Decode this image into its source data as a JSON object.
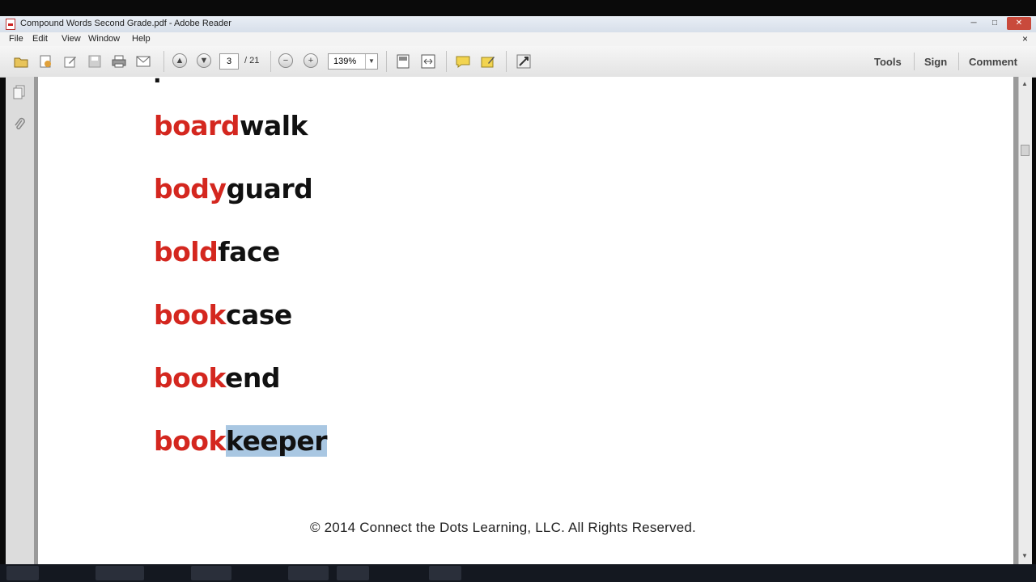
{
  "window": {
    "title": "Compound Words Second Grade.pdf - Adobe Reader",
    "controls": {
      "minimize": "─",
      "maximize": "□",
      "close": "✕"
    }
  },
  "menu": {
    "items": [
      "File",
      "Edit",
      "View",
      "Window",
      "Help"
    ],
    "doc_close": "×"
  },
  "toolbar": {
    "page_current": "3",
    "page_total": "/ 21",
    "zoom": "139%",
    "tools_label": "Tools",
    "sign_label": "Sign",
    "comment_label": "Comment"
  },
  "document": {
    "cutoff_text": "·",
    "words": [
      {
        "first": "board",
        "second": "walk",
        "selected": false
      },
      {
        "first": "body",
        "second": "guard",
        "selected": false
      },
      {
        "first": "bold",
        "second": "face",
        "selected": false
      },
      {
        "first": "book",
        "second": "case",
        "selected": false
      },
      {
        "first": "book",
        "second": "end",
        "selected": false
      },
      {
        "first": "book",
        "second": "keeper",
        "selected": true
      }
    ],
    "footer": "© 2014 Connect the Dots Learning, LLC. All Rights Reserved."
  },
  "colors": {
    "first_part": "#d4271f",
    "second_part": "#111111",
    "selection": "#a9c7e2"
  }
}
